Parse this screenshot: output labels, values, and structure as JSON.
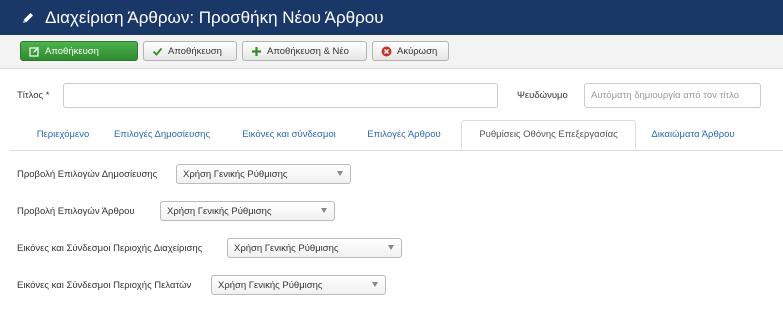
{
  "header": {
    "title": "Διαχείριση Άρθρων: Προσθήκη Νέου Άρθρου",
    "icon": "pencil-icon"
  },
  "toolbar": {
    "save_label": "Αποθήκευση",
    "apply_label": "Αποθήκευση",
    "save_new_label": "Αποθήκευση & Νέο",
    "cancel_label": "Ακύρωση"
  },
  "form": {
    "title_label": "Τίτλος *",
    "title_value": "",
    "alias_label": "Ψευδώνυμο",
    "alias_placeholder": "Αυτόματη δημιουργία από τον τίτλο"
  },
  "tabs": [
    {
      "label": "Περιεχόμενο"
    },
    {
      "label": "Επιλογές Δημοσίευσης"
    },
    {
      "label": "Εικόνες και σύνδεσμοι"
    },
    {
      "label": "Επιλογές Άρθρου"
    },
    {
      "label": "Ρυθμίσεις Οθόνης Επεξεργασίας",
      "active": true
    },
    {
      "label": "Δικαιώματα Άρθρου"
    }
  ],
  "fields": [
    {
      "label": "Προβολή Επιλογών Δημοσίευσης",
      "value": "Χρήση Γενικής Ρύθμισης"
    },
    {
      "label": "Προβολή Επιλογών Άρθρου",
      "value": "Χρήση Γενικής Ρύθμισης"
    },
    {
      "label": "Εικόνες και Σύνδεσμοι Περιοχής Διαχείρισης",
      "value": "Χρήση Γενικής Ρύθμισης"
    },
    {
      "label": "Εικόνες και Σύνδεσμοι Περιοχής Πελατών",
      "value": "Χρήση Γενικής Ρύθμισης"
    }
  ],
  "colors": {
    "header_bg": "#1a3867",
    "save_green": "#3a9a3a",
    "tab_link": "#2a69b8"
  }
}
